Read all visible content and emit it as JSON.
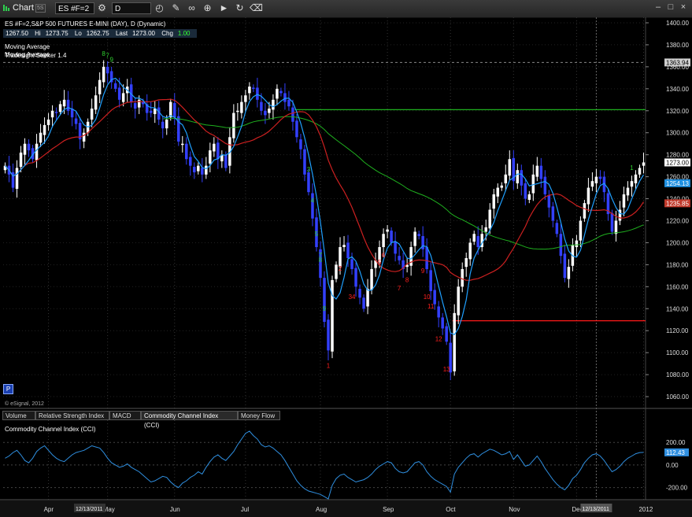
{
  "window": {
    "title": "Chart",
    "symbol_value": "ES #F=2",
    "interval_value": "D",
    "title_badge": "5S"
  },
  "header": {
    "symbol_line": "ES #F=2,S&P 500 FUTURES E-MINI (DAY), D (Dynamic)",
    "ohlc": {
      "open": "1267.50",
      "hi_label": "Hi",
      "hi": "1273.75",
      "lo_label": "Lo",
      "lo": "1262.75",
      "last_label": "Last",
      "last": "1273.00",
      "chg_label": "Chg",
      "chg": "1.00"
    },
    "studies": [
      "Moving Average",
      "Moving Average",
      "Tradesight Seeker 1.4"
    ]
  },
  "copyright": "© eSignal, 2012",
  "p_badge": "P",
  "tabs": [
    "Volume",
    "Relative Strength Index",
    "MACD",
    "Commodity Channel Index (CCI)",
    "Money Flow"
  ],
  "indicator_title": "Commodity Channel Index (CCI)",
  "price_axis": {
    "ticks": [
      1060,
      1080,
      1100,
      1120,
      1140,
      1160,
      1180,
      1200,
      1220,
      1240,
      1260,
      1280,
      1300,
      1320,
      1340,
      1360,
      1380,
      1400
    ]
  },
  "price_tags": [
    {
      "value": "1363.94",
      "bg": "#cfcfcf",
      "fg": "#000"
    },
    {
      "value": "1273.00",
      "bg": "#ffffff",
      "fg": "#000"
    },
    {
      "value": "1254.13",
      "bg": "#1f8fe0",
      "fg": "#fff"
    },
    {
      "value": "1235.85",
      "bg": "#c0392b",
      "fg": "#fff"
    }
  ],
  "cci_axis": {
    "ticks": [
      "200.00",
      "0.00",
      "-200.00"
    ],
    "current": "112.43"
  },
  "time_axis": {
    "labels": [
      "Apr",
      "May",
      "Jun",
      "Jul",
      "Aug",
      "Sep",
      "Oct",
      "Nov",
      "Dec",
      "2012"
    ],
    "left_tag": "12/13/2011",
    "right_tag": "12/13/2011"
  },
  "colors": {
    "up": "#ffffff",
    "down": "#3340ff",
    "ma_fast": "#1fa0ff",
    "ma_slow": "#cc2020",
    "ma_long": "#1fb01f",
    "green_level": "#1fb01f",
    "red_level": "#ff1a1a",
    "cci": "#2f8fe0"
  },
  "chart_data": {
    "type": "candlestick",
    "ylim": [
      1050,
      1405
    ],
    "horizontal_levels": [
      {
        "name": "",
        "value": 1321,
        "color": "green",
        "from_day": 74
      },
      {
        "name": "",
        "value": 1129,
        "color": "red",
        "from_day": 114
      },
      {
        "name": "",
        "value": 1363.94,
        "color": "gray-dashed",
        "from_day": 0
      }
    ],
    "month_starts": [
      {
        "label": "Apr",
        "day": 11
      },
      {
        "label": "May",
        "day": 26
      },
      {
        "label": "Jun",
        "day": 43
      },
      {
        "label": "Jul",
        "day": 61
      },
      {
        "label": "Aug",
        "day": 80
      },
      {
        "label": "Sep",
        "day": 97
      },
      {
        "label": "Oct",
        "day": 113
      },
      {
        "label": "Nov",
        "day": 129
      },
      {
        "label": "Dec",
        "day": 145
      },
      {
        "label": "2012",
        "day": 162
      }
    ],
    "closes": [
      1270,
      1262,
      1250,
      1268,
      1282,
      1290,
      1284,
      1276,
      1290,
      1300,
      1307,
      1312,
      1320,
      1318,
      1326,
      1330,
      1320,
      1314,
      1308,
      1294,
      1300,
      1310,
      1322,
      1334,
      1348,
      1360,
      1354,
      1346,
      1340,
      1330,
      1336,
      1342,
      1328,
      1322,
      1330,
      1326,
      1318,
      1318,
      1322,
      1312,
      1304,
      1312,
      1328,
      1314,
      1292,
      1290,
      1276,
      1270,
      1264,
      1270,
      1262,
      1270,
      1284,
      1290,
      1276,
      1280,
      1268,
      1296,
      1318,
      1320,
      1328,
      1334,
      1342,
      1340,
      1330,
      1320,
      1316,
      1322,
      1330,
      1340,
      1336,
      1328,
      1324,
      1310,
      1296,
      1285,
      1262,
      1246,
      1222,
      1196,
      1168,
      1128,
      1102,
      1166,
      1180,
      1196,
      1198,
      1186,
      1176,
      1160,
      1150,
      1140,
      1158,
      1176,
      1184,
      1196,
      1208,
      1212,
      1200,
      1190,
      1184,
      1176,
      1180,
      1196,
      1210,
      1206,
      1194,
      1176,
      1156,
      1144,
      1132,
      1122,
      1110,
      1082,
      1136,
      1160,
      1176,
      1186,
      1200,
      1208,
      1196,
      1208,
      1214,
      1230,
      1244,
      1250,
      1252,
      1262,
      1276,
      1256,
      1266,
      1252,
      1240,
      1244,
      1262,
      1270,
      1258,
      1244,
      1232,
      1220,
      1208,
      1188,
      1168,
      1178,
      1198,
      1202,
      1220,
      1236,
      1250,
      1256,
      1260,
      1258,
      1246,
      1226,
      1210,
      1220,
      1230,
      1244,
      1250,
      1256,
      1262,
      1268,
      1273
    ],
    "annotations": [
      {
        "text": "1",
        "day": 82,
        "color": "red"
      },
      {
        "text": "2",
        "day": 85,
        "color": "red"
      },
      {
        "text": "34",
        "day": 88,
        "color": "red"
      },
      {
        "text": "5",
        "day": 95,
        "color": "red"
      },
      {
        "text": "6",
        "day": 96,
        "color": "red"
      },
      {
        "text": "7",
        "day": 100,
        "color": "red"
      },
      {
        "text": "8",
        "day": 102,
        "color": "red"
      },
      {
        "text": "9",
        "day": 106,
        "color": "red"
      },
      {
        "text": "10",
        "day": 107,
        "color": "red"
      },
      {
        "text": "11",
        "day": 108,
        "color": "red"
      },
      {
        "text": "12",
        "day": 110,
        "color": "red"
      },
      {
        "text": "13",
        "day": 112,
        "color": "red"
      },
      {
        "text": "9",
        "day": 81,
        "color": "green"
      },
      {
        "text": "8",
        "day": 80,
        "color": "green"
      },
      {
        "text": "7",
        "day": 80,
        "color": "green"
      },
      {
        "text": "5",
        "day": 79,
        "color": "green"
      },
      {
        "text": "4",
        "day": 78,
        "color": "green"
      },
      {
        "text": "3",
        "day": 77,
        "color": "green"
      },
      {
        "text": "8",
        "day": 25,
        "color": "green"
      },
      {
        "text": "7",
        "day": 26,
        "color": "green"
      },
      {
        "text": "9",
        "day": 27,
        "color": "green"
      },
      {
        "text": "1",
        "day": 159,
        "color": "green"
      }
    ],
    "cci": [
      60,
      80,
      110,
      130,
      90,
      40,
      20,
      60,
      120,
      150,
      170,
      130,
      90,
      60,
      40,
      30,
      60,
      90,
      110,
      120,
      130,
      150,
      170,
      160,
      150,
      110,
      60,
      20,
      0,
      -20,
      -10,
      10,
      -20,
      -40,
      -60,
      -90,
      -120,
      -150,
      -140,
      -120,
      -100,
      -110,
      -150,
      -180,
      -200,
      -160,
      -140,
      -110,
      -90,
      -60,
      -80,
      -20,
      30,
      70,
      90,
      60,
      40,
      80,
      120,
      180,
      230,
      280,
      300,
      260,
      230,
      180,
      160,
      170,
      150,
      120,
      90,
      40,
      -20,
      -80,
      -140,
      -180,
      -210,
      -230,
      -240,
      -250,
      -260,
      -280,
      -300,
      -180,
      -120,
      -90,
      -80,
      -110,
      -130,
      -150,
      -140,
      -130,
      -110,
      -80,
      -40,
      -10,
      10,
      30,
      20,
      -30,
      -60,
      -70,
      -60,
      -20,
      20,
      30,
      0,
      -60,
      -100,
      -130,
      -150,
      -170,
      -190,
      -240,
      -80,
      -20,
      20,
      60,
      90,
      100,
      70,
      100,
      120,
      140,
      130,
      110,
      90,
      100,
      120,
      50,
      90,
      40,
      -10,
      0,
      40,
      80,
      30,
      -30,
      -80,
      -130,
      -170,
      -200,
      -220,
      -180,
      -120,
      -90,
      -40,
      20,
      60,
      90,
      100,
      80,
      40,
      -10,
      -60,
      -40,
      -10,
      30,
      60,
      80,
      100,
      110,
      112
    ]
  }
}
